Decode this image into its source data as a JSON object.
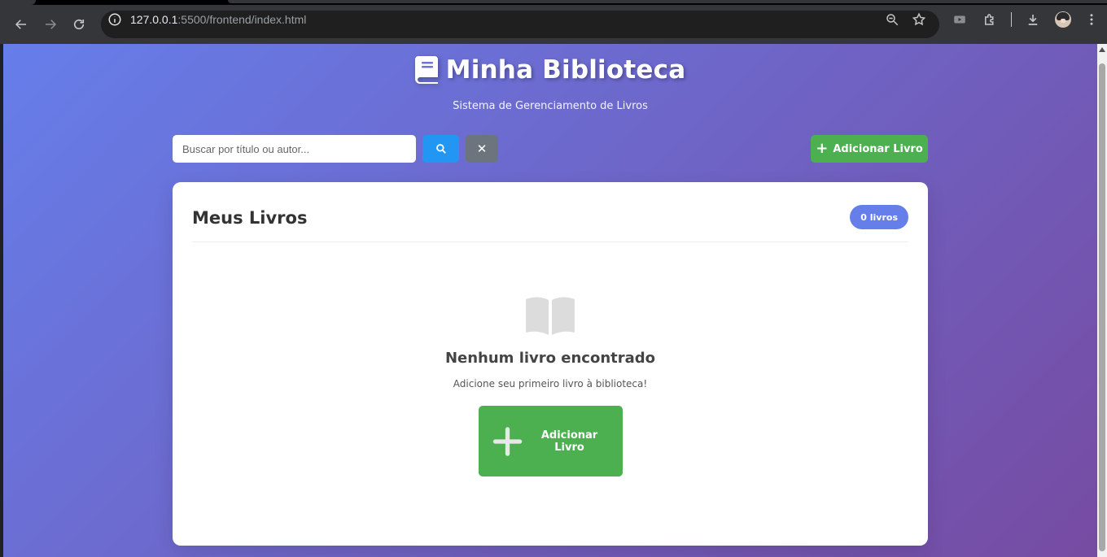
{
  "browser": {
    "url_host": "127.0.0.1",
    "url_rest": ":5500/frontend/index.html"
  },
  "header": {
    "title": "Minha Biblioteca",
    "subtitle": "Sistema de Gerenciamento de Livros",
    "icon": "book-icon"
  },
  "controls": {
    "search_placeholder": "Buscar por título ou autor...",
    "search_icon": "search-icon",
    "clear_label": "✕",
    "add_label": "Adicionar Livro"
  },
  "books": {
    "title": "Meus Livros",
    "count_label": "0 livros",
    "empty": {
      "icon": "open-book-icon",
      "title": "Nenhum livro encontrado",
      "description": "Adicione seu primeiro livro à biblioteca!",
      "button_label": "Adicionar Livro"
    }
  },
  "colors": {
    "gradient_start": "#667eea",
    "gradient_end": "#764ba2",
    "add_green": "#4CAF50",
    "search_blue": "#2196F3",
    "clear_gray": "#6c757d"
  }
}
